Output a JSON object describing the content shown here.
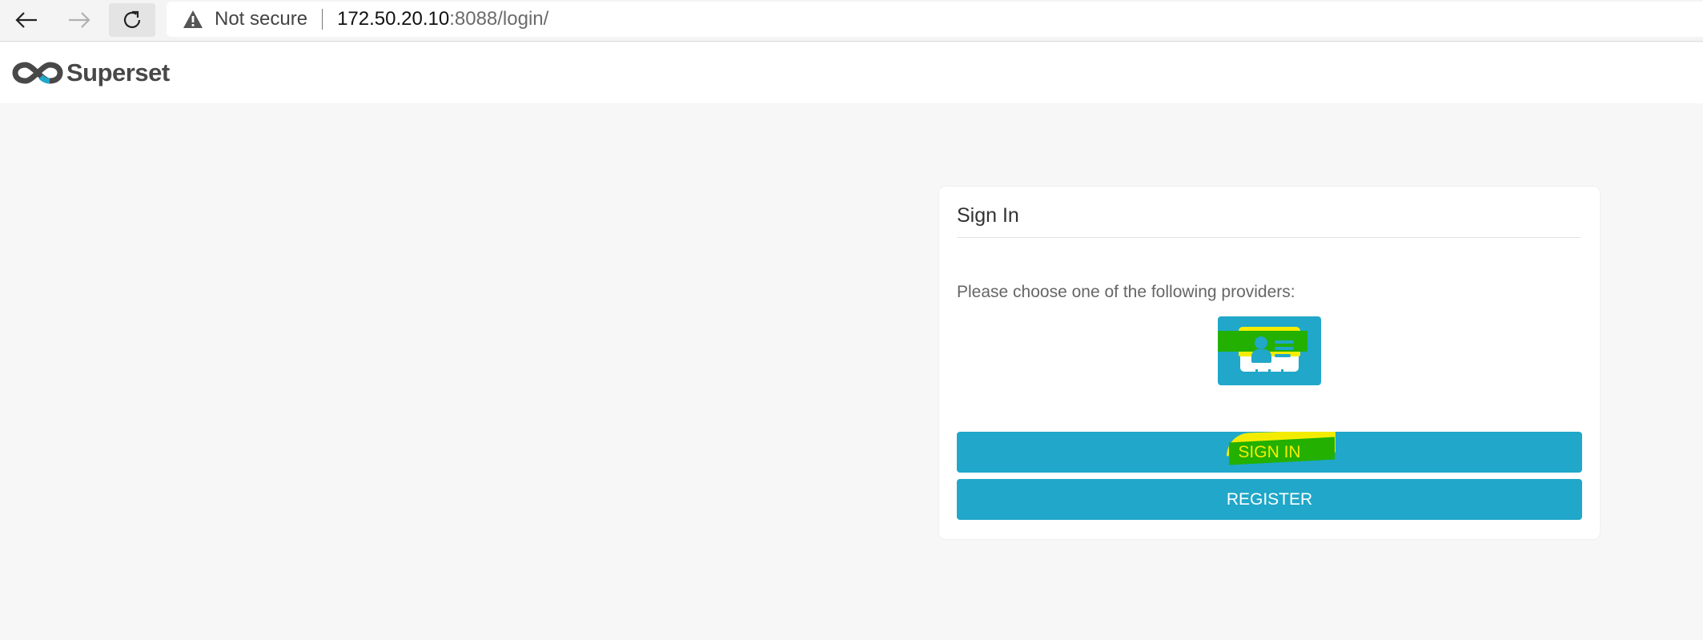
{
  "browser": {
    "security_text": "Not secure",
    "url_host": "172.50.20.10",
    "url_rest": ":8088/login/"
  },
  "app": {
    "brand": "Superset"
  },
  "login": {
    "heading": "Sign In",
    "prompt": "Please choose one of the following providers:",
    "provider_icon": "id-card-icon",
    "signin_label": "SIGN IN",
    "register_label": "REGISTER"
  },
  "colors": {
    "accent": "#20a7c9",
    "highlight_yellow": "#f5ec00",
    "highlight_green": "#23b000",
    "page_bg": "#f7f7f7"
  }
}
